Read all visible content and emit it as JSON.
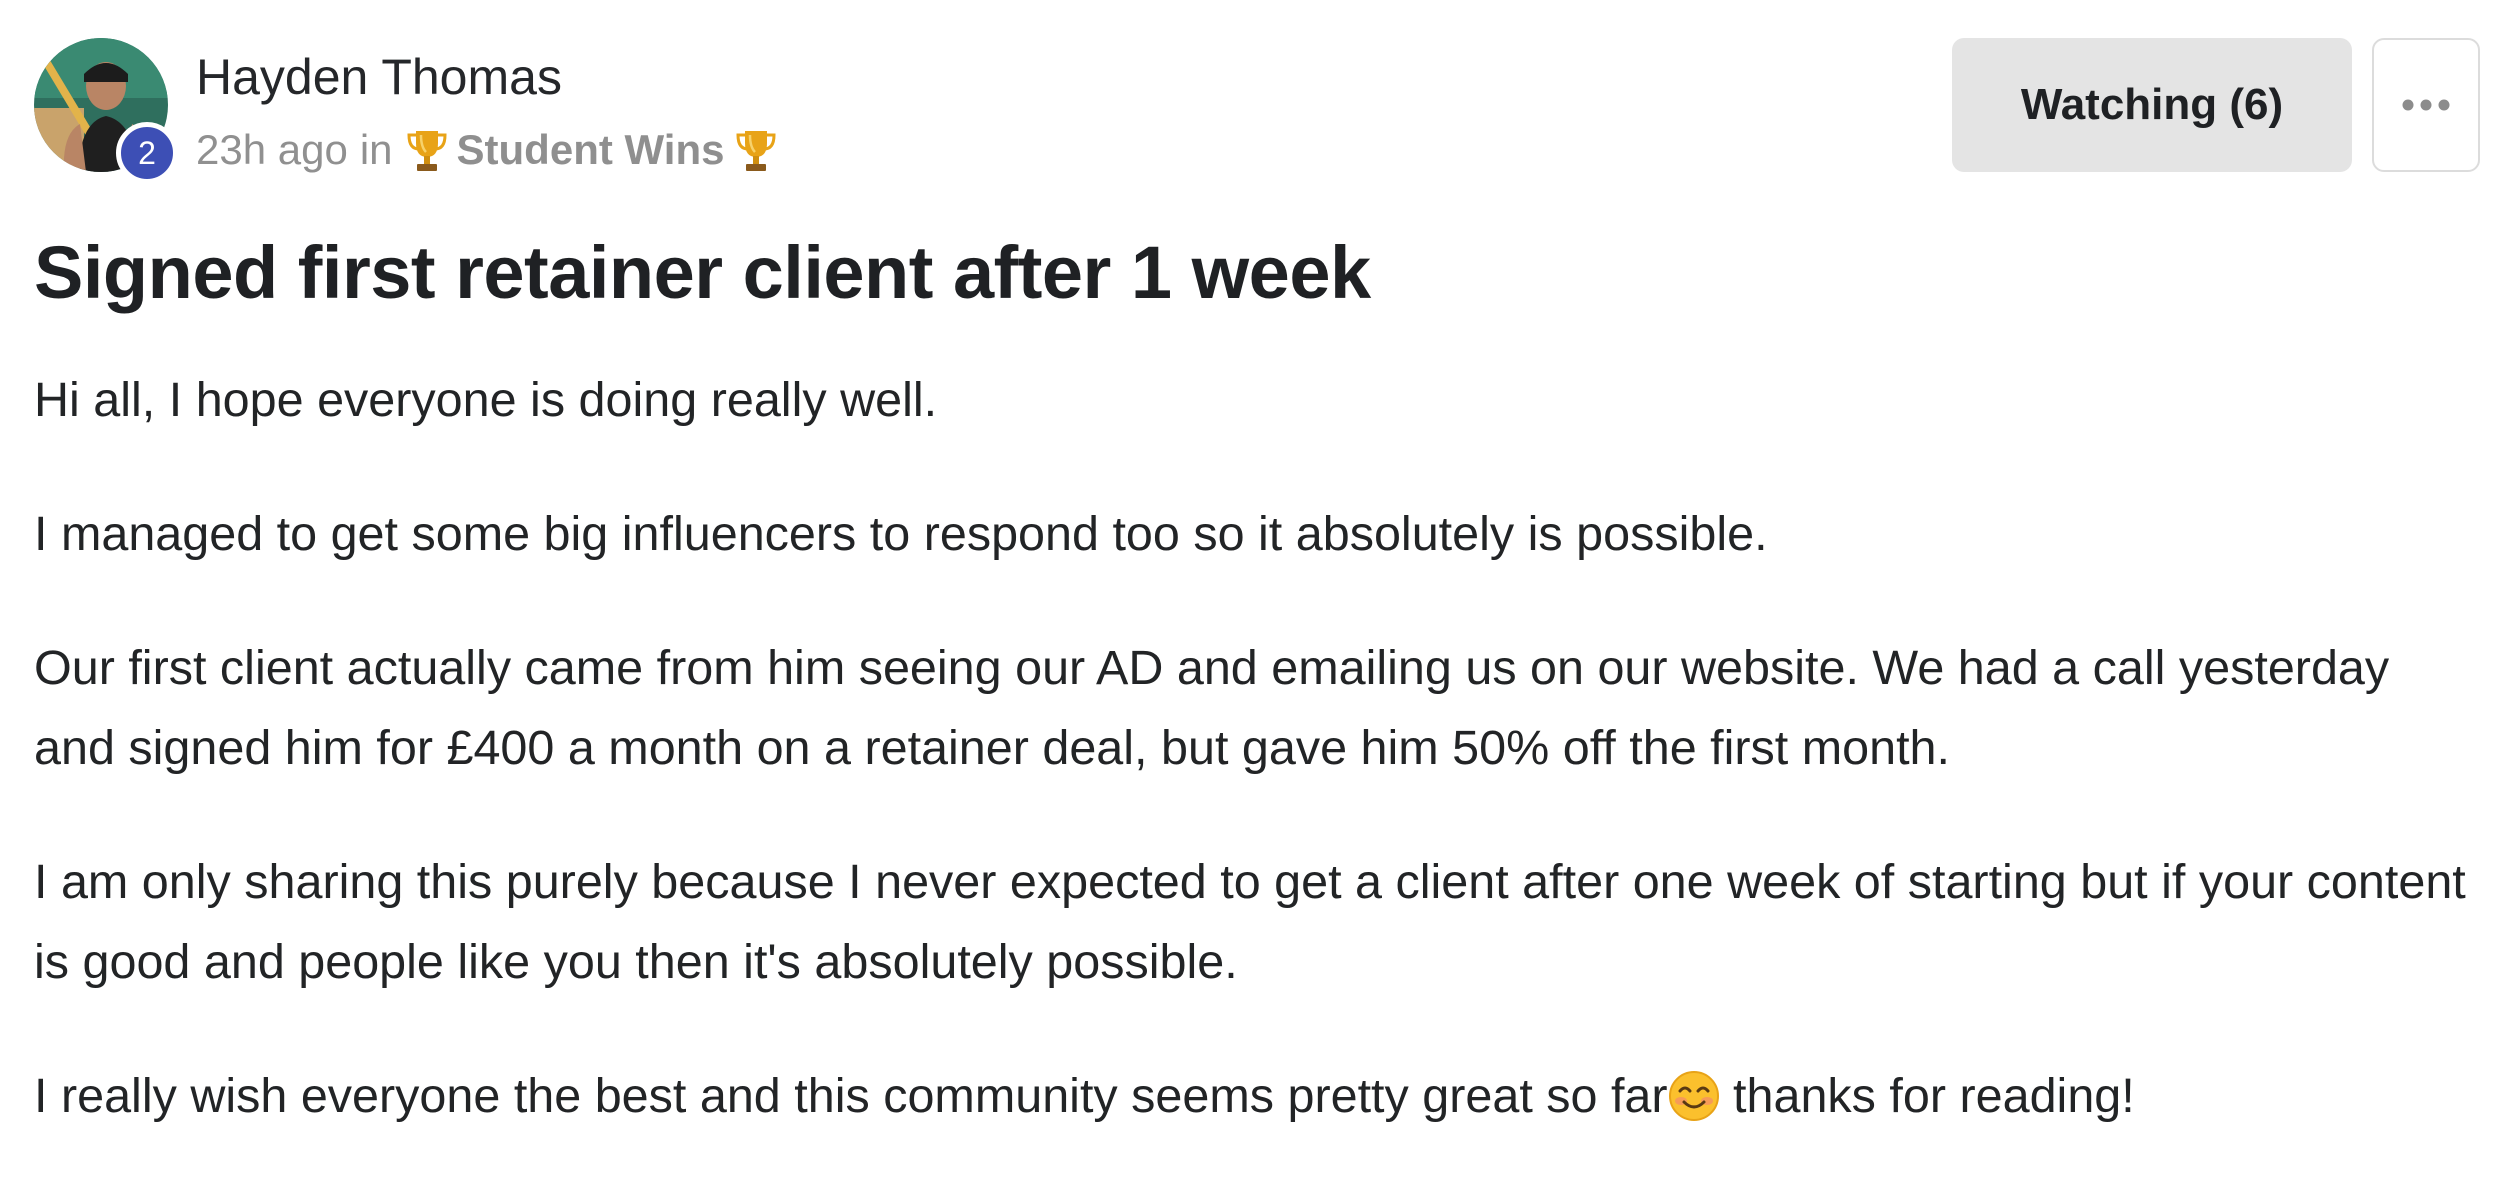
{
  "author": {
    "name": "Hayden Thomas",
    "level": "2",
    "avatar_icon": "avatar-photo"
  },
  "meta": {
    "time": "23h ago",
    "in_word": "in",
    "category": "Student Wins",
    "category_icon": "trophy-icon"
  },
  "actions": {
    "watch_label": "Watching (6)",
    "more_icon": "ellipsis-icon"
  },
  "post": {
    "title": "Signed first retainer client after 1 week",
    "paragraphs": [
      "Hi all, I hope everyone is doing really well.",
      "I managed to get some big influencers to respond too so it absolutely is possible.",
      "Our first client actually came from him seeing our AD and emailing us on our website. We had a call yesterday and signed him for £400 a month on a retainer deal, but gave him 50% off the first month.",
      "I am only sharing this purely because I never expected to get a client after one week of starting but if your content is good and people like you then it's absolutely possible.",
      "I really wish everyone the best and this community seems pretty great so far"
    ],
    "last_paragraph_emoji": "smiling-face-icon",
    "last_paragraph_tail": " thanks for reading!"
  },
  "colors": {
    "badge": "#3d4fb5",
    "watch_button_bg": "#e4e4e4",
    "meta_text": "#909090",
    "trophy": "#e8a317"
  }
}
